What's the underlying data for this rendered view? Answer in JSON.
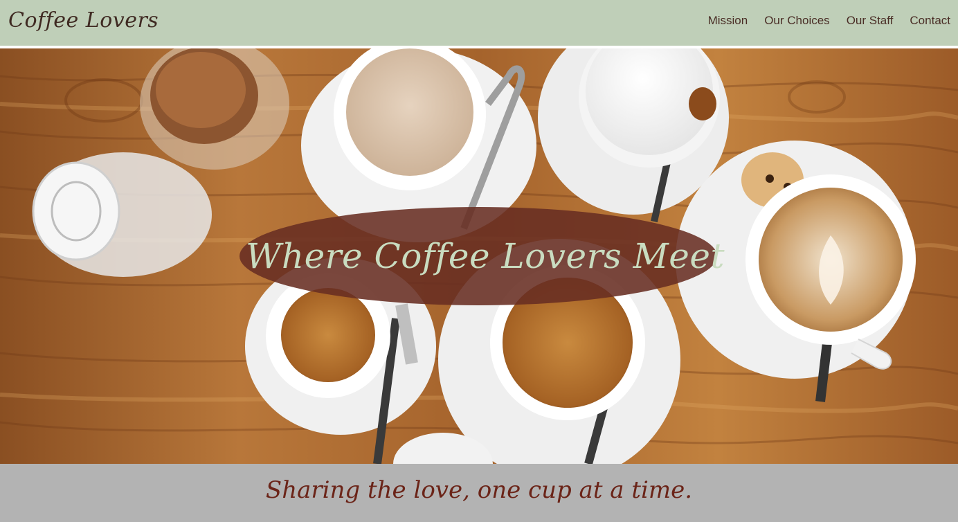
{
  "brand": {
    "name": "Coffee Lovers"
  },
  "nav": {
    "items": [
      {
        "label": "Mission"
      },
      {
        "label": "Our Choices"
      },
      {
        "label": "Our Staff"
      },
      {
        "label": "Contact"
      }
    ]
  },
  "hero": {
    "title": "Where Coffee Lovers Meet",
    "image": "coffee-cups-on-wooden-table"
  },
  "footer": {
    "tagline": "Sharing the love, one cup at a time."
  },
  "colors": {
    "header_bg": "#bfcfb8",
    "banner_bg": "#682e22",
    "banner_text": "#c9dcc0",
    "tagline_bar": "#b3b3b3",
    "tagline_text": "#6b2418"
  }
}
